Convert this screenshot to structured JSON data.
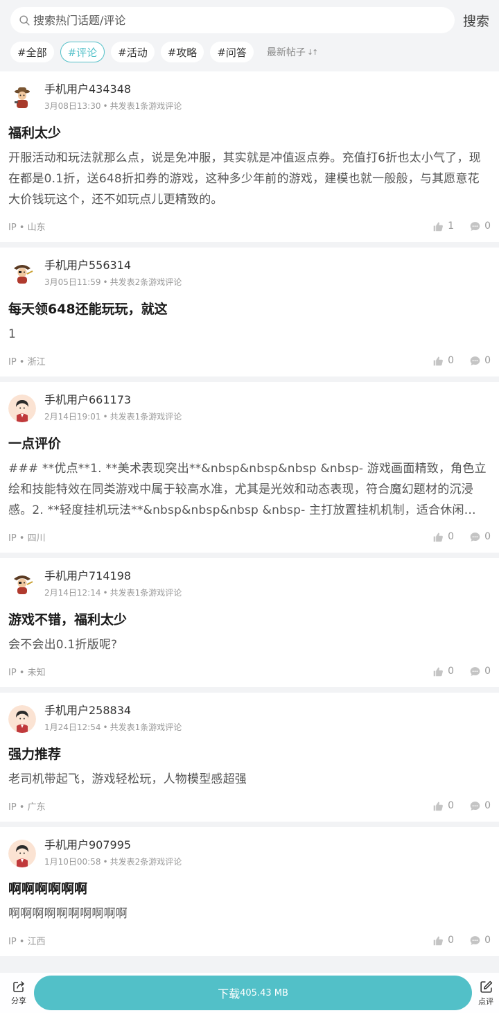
{
  "search": {
    "placeholder": "搜索热门话题/评论",
    "button_label": "搜索"
  },
  "tags": [
    {
      "label": "#全部",
      "active": false
    },
    {
      "label": "#评论",
      "active": true
    },
    {
      "label": "#活动",
      "active": false
    },
    {
      "label": "#攻略",
      "active": false
    },
    {
      "label": "#问答",
      "active": false
    }
  ],
  "sort_label": "最新帖子",
  "sort_icon": "sort-arrows-icon",
  "posts": [
    {
      "user": "手机用户434348",
      "date": "3月08日13:30",
      "stat": "共发表1条游戏评论",
      "avatar": "cowboy-avatar",
      "title": "福利太少",
      "content": "开服活动和玩法就那么点，说是免冲服，其实就是冲值返点券。充值打6折也太小气了，现在都是0.1折，送648折扣券的游戏，这种多少年前的游戏，建模也就一般般，与其愿意花大价钱玩这个，还不如玩点儿更精致的。",
      "ip": "IP • 山东",
      "likes": "1",
      "comments": "0"
    },
    {
      "user": "手机用户556314",
      "date": "3月05日11:59",
      "stat": "共发表2条游戏评论",
      "avatar": "pirate-avatar",
      "title": "每天领648还能玩玩，就这",
      "content": "1",
      "ip": "IP • 浙江",
      "likes": "0",
      "comments": "0"
    },
    {
      "user": "手机用户661173",
      "date": "2月14日19:01",
      "stat": "共发表1条游戏评论",
      "avatar": "boy-avatar",
      "title": "一点评价",
      "content": "### **优点**1. **美术表现突出**&nbsp&nbsp&nbsp &nbsp- 游戏画面精致，角色立绘和技能特效在同类游戏中属于较高水准，尤其是光效和动态表现，符合魔幻题材的沉浸感。2. **轻度挂机玩法**&nbsp&nbsp&nbsp &nbsp- 主打放置挂机机制，适合休闲…",
      "ip": "IP • 四川",
      "likes": "0",
      "comments": "0"
    },
    {
      "user": "手机用户714198",
      "date": "2月14日12:14",
      "stat": "共发表1条游戏评论",
      "avatar": "pirate-avatar",
      "title": "游戏不错，福利太少",
      "content": "会不会出0.1折版呢?",
      "ip": "IP • 未知",
      "likes": "0",
      "comments": "0"
    },
    {
      "user": "手机用户258834",
      "date": "1月24日12:54",
      "stat": "共发表1条游戏评论",
      "avatar": "boy-avatar",
      "title": "强力推荐",
      "content": "老司机带起飞，游戏轻松玩，人物模型感超强",
      "ip": "IP • 广东",
      "likes": "0",
      "comments": "0"
    },
    {
      "user": "手机用户907995",
      "date": "1月10日00:58",
      "stat": "共发表2条游戏评论",
      "avatar": "boy-avatar",
      "title": "啊啊啊啊啊啊",
      "content": "啊啊啊啊啊啊啊啊啊啊",
      "ip": "IP • 江西",
      "likes": "0",
      "comments": "0"
    }
  ],
  "bottom": {
    "share_label": "分享",
    "download_label": "下载",
    "download_size": "405.43 MB",
    "review_label": "点评"
  },
  "colors": {
    "accent": "#52c0c8"
  }
}
